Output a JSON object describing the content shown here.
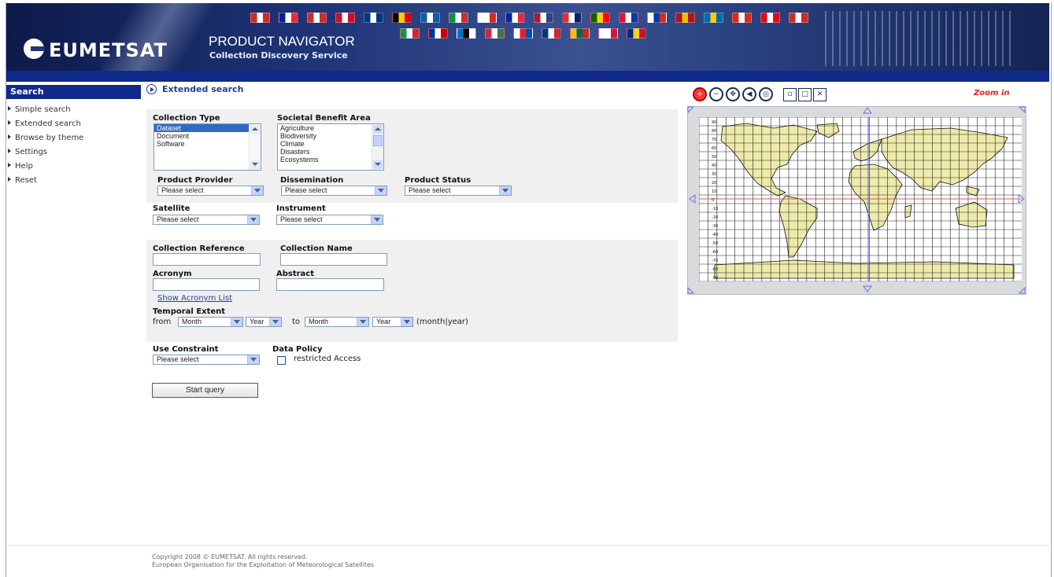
{
  "header": {
    "logo": "EUMETSAT",
    "title": "PRODUCT NAVIGATOR",
    "subtitle": "Collection Discovery Service",
    "flag_colors": [
      [
        "#cc2b2b",
        "#ffffff",
        "#cc2b2b"
      ],
      [
        "#002395",
        "#ffffff",
        "#ed2939"
      ],
      [
        "#cc2b2b",
        "#ffffff",
        "#cc2b2b"
      ],
      [
        "#c8102e",
        "#ffffff",
        "#c8102e"
      ],
      [
        "#003580",
        "#ffffff",
        "#003580"
      ],
      [
        "#000000",
        "#ffcc00",
        "#dd0000"
      ],
      [
        "#0d5eaf",
        "#ffffff",
        "#0d5eaf"
      ],
      [
        "#009246",
        "#ffffff",
        "#ce2b37"
      ],
      [
        "#ffffff",
        "#ffffff",
        "#d52b1e"
      ],
      [
        "#00239c",
        "#ffffff",
        "#ed2939"
      ],
      [
        "#ae1c28",
        "#ffffff",
        "#21468b"
      ],
      [
        "#ef2b2d",
        "#ffffff",
        "#002868"
      ],
      [
        "#006600",
        "#ffcc00",
        "#ff0000"
      ],
      [
        "#dc143c",
        "#ffffff",
        "#0039a6"
      ],
      [
        "#ffffff",
        "#0039a6",
        "#d52b1e"
      ],
      [
        "#aa151b",
        "#f1bf00",
        "#aa151b"
      ],
      [
        "#006aa7",
        "#fecc00",
        "#006aa7"
      ],
      [
        "#d52b1e",
        "#ffffff",
        "#d52b1e"
      ],
      [
        "#e30a17",
        "#ffffff",
        "#e30a17"
      ],
      [
        "#cc2b2b",
        "#ffffff",
        "#cc2b2b"
      ],
      [
        "#009a44",
        "#ffffff",
        "#d22630"
      ],
      [
        "#0033a0",
        "#ffffff",
        "#cc0000"
      ],
      [
        "#0072ce",
        "#000000",
        "#ffffff"
      ],
      [
        "#ce2939",
        "#ffffff",
        "#477050"
      ],
      [
        "#ffffff",
        "#ee1c25",
        "#0052b4"
      ],
      [
        "#003580",
        "#ffffff",
        "#cc2b2b"
      ],
      [
        "#fdb913",
        "#006a44",
        "#c1272d"
      ],
      [
        "#ffffff",
        "#ffffff",
        "#dc143c"
      ],
      [
        "#002b7f",
        "#fcd116",
        "#ce1126"
      ]
    ]
  },
  "sidebar": {
    "header": "Search",
    "items": [
      "Simple search",
      "Extended search",
      "Browse by theme",
      "Settings",
      "Help",
      "Reset"
    ]
  },
  "main": {
    "heading": "Extended search",
    "collection_type": {
      "label": "Collection Type",
      "options": [
        "Dataset",
        "Document",
        "Software"
      ],
      "selected": "Dataset"
    },
    "societal_benefit": {
      "label": "Societal Benefit Area",
      "options": [
        "Agriculture",
        "Biodiversity",
        "Climate",
        "Disasters",
        "Ecosystems"
      ]
    },
    "product_provider": {
      "label": "Product Provider",
      "value": "Please select"
    },
    "dissemination": {
      "label": "Dissemination",
      "value": "Please select"
    },
    "product_status": {
      "label": "Product Status",
      "value": "Please select"
    },
    "satellite": {
      "label": "Satellite",
      "value": "Please select"
    },
    "instrument": {
      "label": "Instrument",
      "value": "Please select"
    },
    "collection_reference": {
      "label": "Collection Reference"
    },
    "collection_name": {
      "label": "Collection Name"
    },
    "acronym": {
      "label": "Acronym"
    },
    "abstract": {
      "label": "Abstract"
    },
    "acronym_link": "Show Acronym List",
    "temporal": {
      "label": "Temporal Extent",
      "from": "from",
      "to": "to",
      "month1": "Month",
      "year1": "Year",
      "month2": "Month",
      "year2": "Year",
      "hint": "(month|year)"
    },
    "use_constraint": {
      "label": "Use Constraint",
      "value": "Please select"
    },
    "data_policy": {
      "label": "Data Policy",
      "checkbox": "restricted Access",
      "checked": false
    },
    "start_button": "Start query"
  },
  "map": {
    "mode": "Zoom in",
    "tools": [
      "zoom-in-tool",
      "zoom-out-tool",
      "pan-tool",
      "back-tool",
      "globe-tool"
    ],
    "square_tools": [
      "zoom-extent-tool",
      "full-extent-tool",
      "clear-tool"
    ],
    "lat_labels": [
      "90",
      "80",
      "70",
      "60",
      "50",
      "40",
      "30",
      "20",
      "10",
      "0",
      "-10",
      "-20",
      "-30",
      "-40",
      "-50",
      "-60",
      "-70",
      "-80",
      "-90"
    ],
    "colors": {
      "land": "#eeeaaa",
      "water": "#ffffff",
      "equator": "#e05050",
      "meridian": "#6a77d6",
      "grid": "#202020"
    }
  },
  "footer": {
    "line1": "Copyright 2008 © EUMETSAT. All rights reserved.",
    "line2": "European Organisation for the Exploitation of Meteorological Satellites"
  }
}
